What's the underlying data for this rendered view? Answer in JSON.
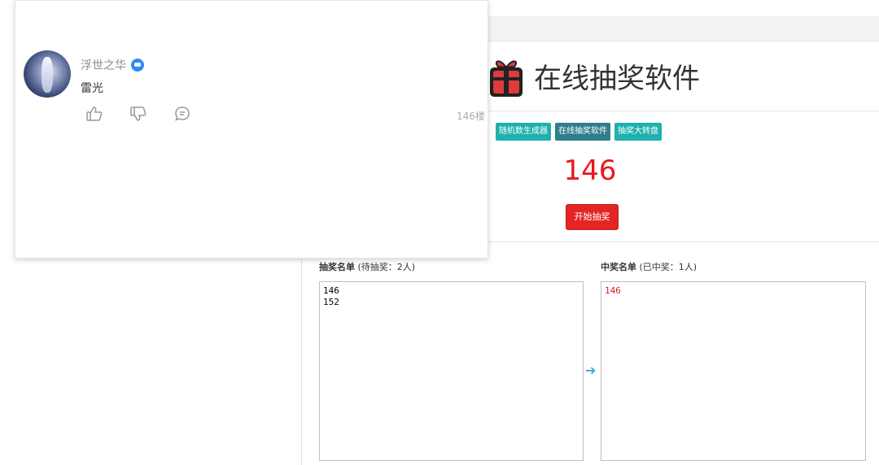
{
  "popup": {
    "username": "浮世之华",
    "comment": "雷光",
    "floor": "146楼",
    "icons": [
      "thumbs-up-icon",
      "thumbs-down-icon",
      "comment-icon",
      "verified-badge-icon"
    ]
  },
  "app": {
    "title": "在线抽奖软件",
    "nav": [
      "随机数生成器",
      "在线抽奖软件",
      "抽奖大转盘"
    ],
    "active_nav": "在线抽奖软件",
    "result_number": "146",
    "start_button": "开始抽奖",
    "pool": {
      "label": "抽奖名单",
      "status": "(待抽奖：2人)",
      "content": "146\n152"
    },
    "winners": {
      "label": "中奖名单",
      "status": "(已中奖：1人)",
      "content": "146"
    }
  },
  "colors": {
    "accent_teal": "#1fb0b0",
    "active_tab": "#2f7f8a",
    "result_red": "#e8171b",
    "start_btn_red": "#e32624"
  }
}
